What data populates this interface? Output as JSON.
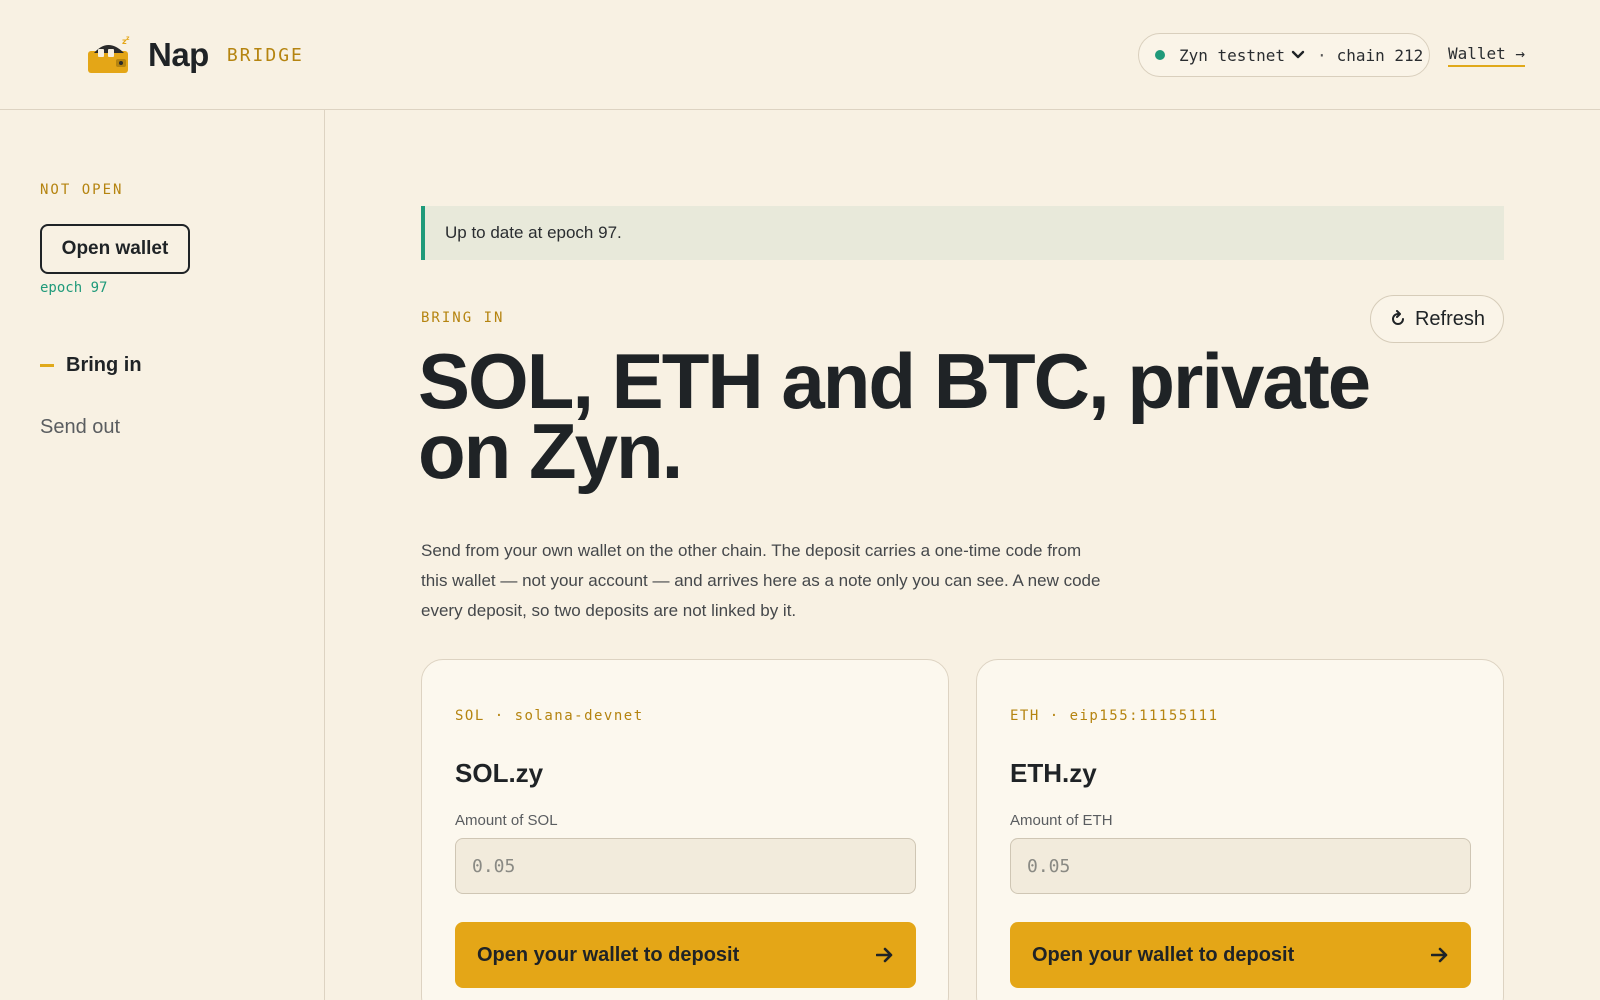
{
  "header": {
    "brand_name": "Nap",
    "brand_tag": "BRIDGE",
    "network": "Zyn testnet",
    "chain": "chain 212",
    "separator": "·",
    "wallet_link": "Wallet →"
  },
  "sidebar": {
    "status": "NOT OPEN",
    "open_wallet_label": "Open wallet",
    "epoch": "epoch 97",
    "nav": [
      {
        "label": "Bring in",
        "active": true
      },
      {
        "label": "Send out",
        "active": false
      }
    ]
  },
  "main": {
    "banner": "Up to date at epoch 97.",
    "eyebrow": "BRING IN",
    "refresh_label": "Refresh",
    "headline": "SOL, ETH and BTC, private on Zyn.",
    "lead": "Send from your own wallet on the other chain. The deposit carries a one-time code from this wallet — not your account — and arrives here as a note only you can see. A new code every deposit, so two deposits are not linked by it.",
    "cards": [
      {
        "chain": "SOL · solana-devnet",
        "title": "SOL.zy",
        "amount_label": "Amount of SOL",
        "placeholder": "0.05",
        "button": "Open your wallet to deposit"
      },
      {
        "chain": "ETH · eip155:11155111",
        "title": "ETH.zy",
        "amount_label": "Amount of ETH",
        "placeholder": "0.05",
        "button": "Open your wallet to deposit"
      }
    ]
  },
  "colors": {
    "background": "#f8f1e3",
    "accent": "#e4a617",
    "success": "#1f9a7a",
    "eyebrow": "#b58410"
  },
  "icons": [
    "sleeping-wallet-logo",
    "status-dot",
    "chevron-down-icon",
    "refresh-icon",
    "arrow-right-icon"
  ]
}
